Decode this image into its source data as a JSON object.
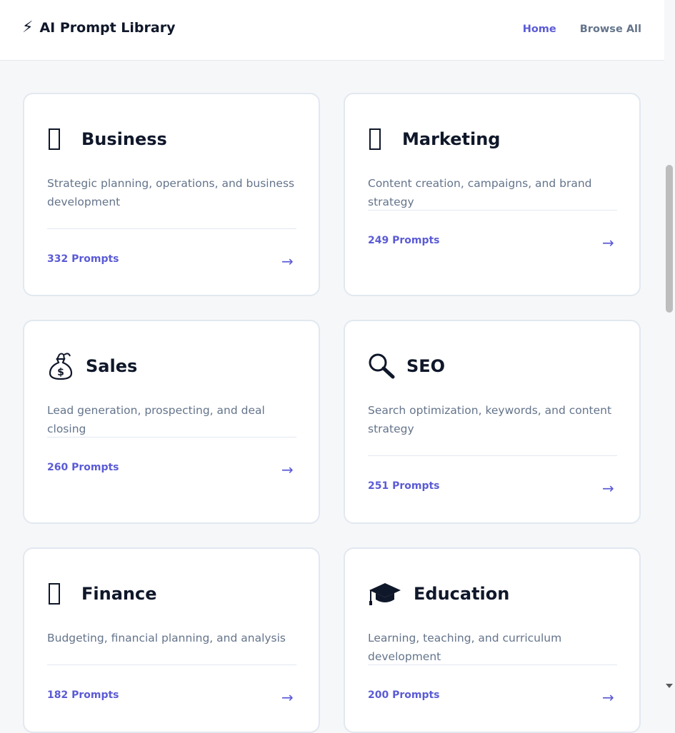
{
  "header": {
    "logo_icon": "lightning-bolt-icon",
    "logo_glyph": "⚡",
    "title": "AI Prompt Library",
    "nav": [
      {
        "label": "Home",
        "active": true
      },
      {
        "label": "Browse All",
        "active": false
      }
    ]
  },
  "colors": {
    "accent": "#5b5bd6",
    "text_dark": "#0f172a",
    "text_muted": "#64748b",
    "background": "#f6f7f9",
    "card_border": "#e2e8f0"
  },
  "categories": [
    {
      "title": "Business",
      "icon": "briefcase-icon",
      "description": "Strategic planning, operations, and business development",
      "count": "332 Prompts",
      "arrow": "→"
    },
    {
      "title": "Marketing",
      "icon": "megaphone-icon",
      "description": "Content creation, campaigns, and brand strategy",
      "count": "249 Prompts",
      "arrow": "→"
    },
    {
      "title": "Sales",
      "icon": "money-bag-icon",
      "description": "Lead generation, prospecting, and deal closing",
      "count": "260 Prompts",
      "arrow": "→"
    },
    {
      "title": "SEO",
      "icon": "magnifying-glass-icon",
      "description": "Search optimization, keywords, and content strategy",
      "count": "251 Prompts",
      "arrow": "→"
    },
    {
      "title": "Finance",
      "icon": "chart-icon",
      "description": "Budgeting, financial planning, and analysis",
      "count": "182 Prompts",
      "arrow": "→"
    },
    {
      "title": "Education",
      "icon": "graduation-cap-icon",
      "description": "Learning, teaching, and curriculum development",
      "count": "200 Prompts",
      "arrow": "→"
    }
  ]
}
